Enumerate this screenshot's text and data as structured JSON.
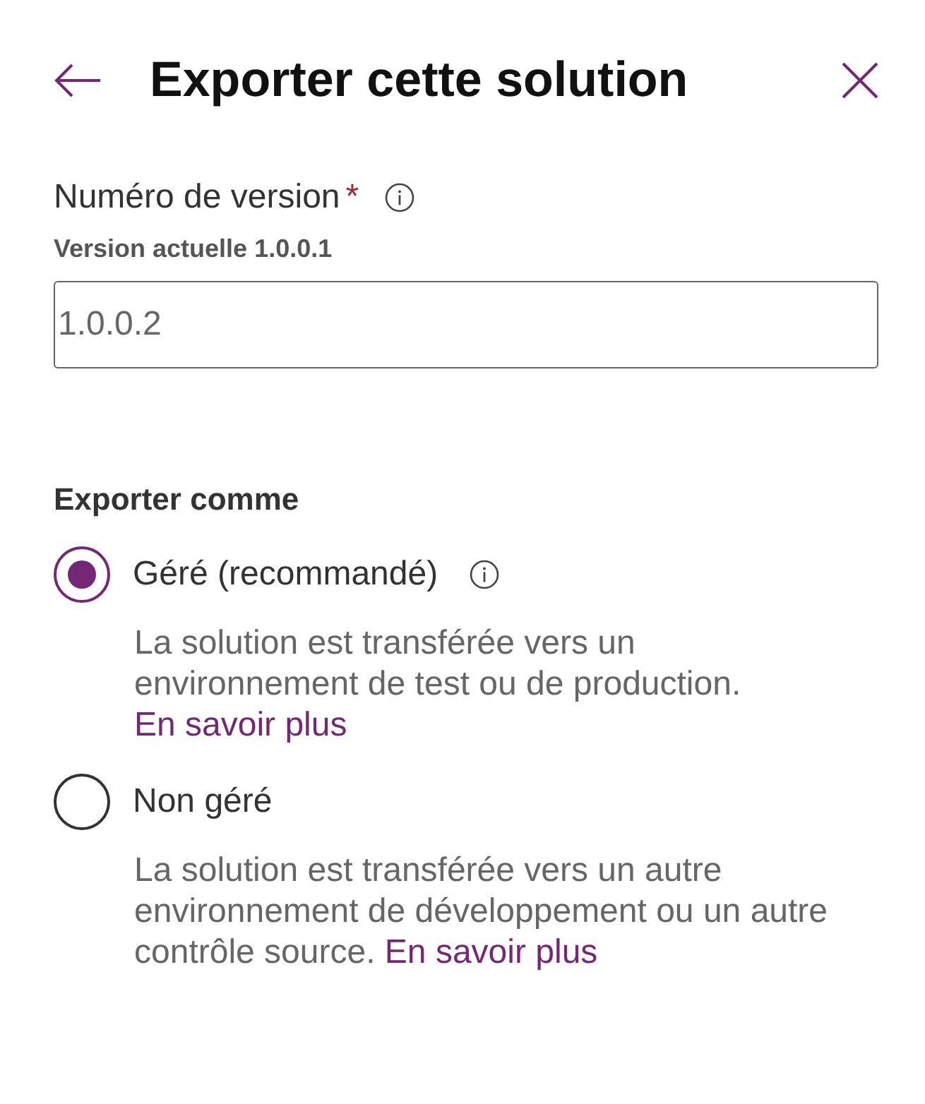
{
  "header": {
    "title": "Exporter cette solution"
  },
  "version_field": {
    "label": "Numéro de version",
    "required_mark": "*",
    "hint": "Version actuelle 1.0.0.1",
    "value": "1.0.0.2"
  },
  "export_as": {
    "heading": "Exporter comme",
    "options": [
      {
        "label": "Géré (recommandé)",
        "selected": true,
        "has_info": true,
        "description": "La solution est transférée vers un environnement de test ou de production.",
        "link": "En savoir plus"
      },
      {
        "label": "Non géré",
        "selected": false,
        "has_info": false,
        "description": "La solution est transférée vers un autre environnement de développement ou un autre contrôle source.",
        "link": "En savoir plus"
      }
    ]
  }
}
